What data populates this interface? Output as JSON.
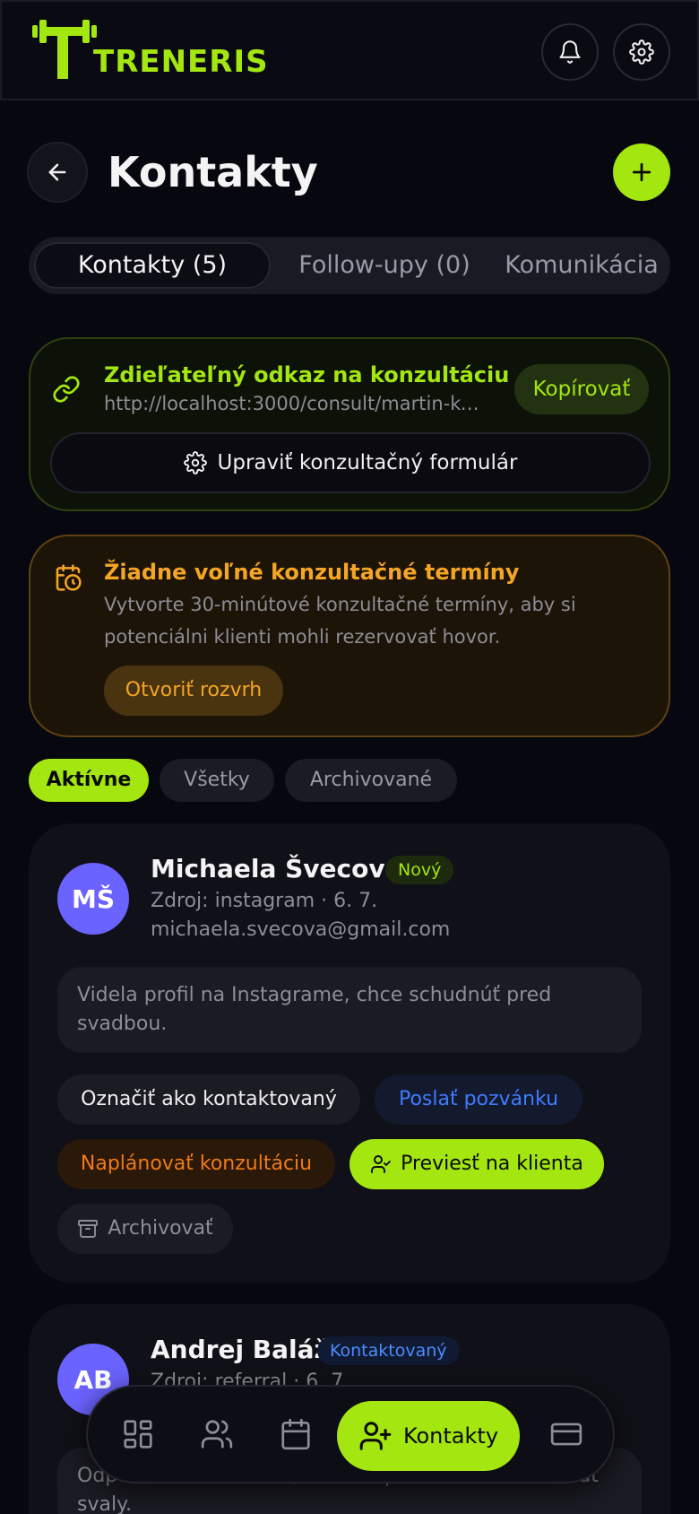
{
  "app": {
    "brand": "TRENERIS",
    "accent": "#a3e610"
  },
  "header": {
    "notifications_icon": "bell-icon",
    "settings_icon": "gear-icon"
  },
  "page": {
    "title": "Kontakty",
    "back_icon": "arrow-left-icon",
    "add_icon": "plus-icon"
  },
  "tabs": [
    {
      "label": "Kontakty (5)",
      "active": true
    },
    {
      "label": "Follow-upy (0)",
      "active": false
    },
    {
      "label": "Komunikácia",
      "active": false
    }
  ],
  "share": {
    "title": "Zdieľateľný odkaz na konzultáciu",
    "url": "http://localhost:3000/consult/martin-ko...",
    "copy_label": "Kopírovať",
    "edit_label": "Upraviť konzultačný formulár"
  },
  "warning": {
    "title": "Žiadne voľné konzultačné termíny",
    "text": "Vytvorte 30-minútové konzultačné termíny, aby si potenciálni klienti mohli rezervovať hovor.",
    "button": "Otvoriť rozvrh",
    "color": "#f5a524"
  },
  "filters": [
    {
      "label": "Aktívne",
      "active": true
    },
    {
      "label": "Všetky",
      "active": false
    },
    {
      "label": "Archivované",
      "active": false
    }
  ],
  "contacts": [
    {
      "initials": "MŠ",
      "name": "Michaela Švecová",
      "status": "Nový",
      "source": "Zdroj: instagram · 6. 7.",
      "email": "michaela.svecova@gmail.com",
      "note": "Videla profil na Instagrame, chce schudnúť pred svadbou.",
      "actions": {
        "mark_contacted": "Označiť ako kontaktovaný",
        "send_invite": "Poslať pozvánku",
        "schedule": "Naplánovať konzultáciu",
        "convert": "Previesť na klienta",
        "archive": "Archivovať"
      }
    },
    {
      "initials": "AB",
      "name": "Andrej Baláž",
      "status": "Kontaktovaný",
      "source": "Zdroj: referral · 6. 7.",
      "note": "Odporučil ho kamarát, chce zlepšiť kondíciu a nabrať svaly."
    }
  ],
  "bottom_nav": {
    "active_label": "Kontakty",
    "items": [
      "dashboard-icon",
      "clients-icon",
      "calendar-icon",
      "add-contact-icon",
      "card-icon"
    ]
  }
}
